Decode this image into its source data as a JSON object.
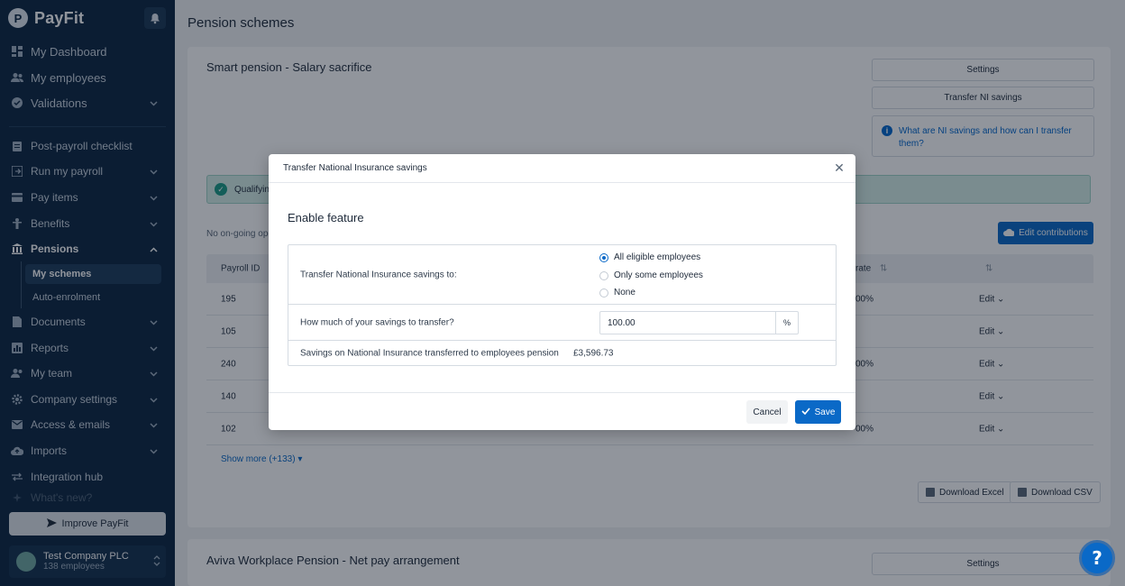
{
  "brand": {
    "name": "PayFit"
  },
  "sidebar": {
    "items": [
      {
        "label": "My Dashboard"
      },
      {
        "label": "My employees"
      },
      {
        "label": "Validations"
      },
      {
        "label": "Post-payroll checklist"
      },
      {
        "label": "Run my payroll"
      },
      {
        "label": "Pay items"
      },
      {
        "label": "Benefits"
      },
      {
        "label": "Pensions"
      },
      {
        "label": "Documents"
      },
      {
        "label": "Reports"
      },
      {
        "label": "My team"
      },
      {
        "label": "Company settings"
      },
      {
        "label": "Access & emails"
      },
      {
        "label": "Imports"
      },
      {
        "label": "Integration hub"
      },
      {
        "label": "What's new?"
      }
    ],
    "pension_sub": [
      {
        "label": "My schemes"
      },
      {
        "label": "Auto-enrolment"
      }
    ],
    "improve_label": "Improve PayFit",
    "company": {
      "name": "Test Company PLC",
      "employees": "138 employees"
    }
  },
  "page": {
    "title": "Pension schemes",
    "scheme1": {
      "title": "Smart pension - Salary sacrifice",
      "settings_label": "Settings",
      "transfer_label": "Transfer NI savings",
      "info_text": "What are NI savings and how can I transfer them?",
      "qualifying_text": "Qualifying",
      "no_ongoing_text": "No on-going ope",
      "edit_contrib_label": "Edit contributions",
      "table": {
        "headers": {
          "payroll_id": "Payroll ID",
          "rate": "rate"
        },
        "rows": [
          {
            "id": "195",
            "rate": "00%",
            "action": "Edit"
          },
          {
            "id": "105",
            "rate": "",
            "action": "Edit"
          },
          {
            "id": "240",
            "rate": "00%",
            "action": "Edit"
          },
          {
            "id": "140",
            "rate": "",
            "action": "Edit"
          },
          {
            "id": "102",
            "rate": "00%",
            "action": "Edit"
          }
        ]
      },
      "show_more": "Show more (+133)",
      "download_excel": "Download Excel",
      "download_csv": "Download CSV"
    },
    "scheme2": {
      "title": "Aviva Workplace Pension - Net pay arrangement",
      "settings_label": "Settings"
    }
  },
  "modal": {
    "title": "Transfer National Insurance savings",
    "heading": "Enable feature",
    "row1_label": "Transfer National Insurance savings to:",
    "options": [
      {
        "label": "All eligible employees",
        "selected": true
      },
      {
        "label": "Only some employees",
        "selected": false
      },
      {
        "label": "None",
        "selected": false
      }
    ],
    "row2_label": "How much of your savings to transfer?",
    "percent_value": "100.00",
    "percent_suffix": "%",
    "row3_label": "Savings on National Insurance transferred to employees pension",
    "amount": "£3,596.73",
    "cancel_label": "Cancel",
    "save_label": "Save"
  },
  "help_label": "?",
  "colors": {
    "sidebar_bg": "#0b2540",
    "primary": "#0a69c7",
    "success_bg": "#d5eee8"
  }
}
